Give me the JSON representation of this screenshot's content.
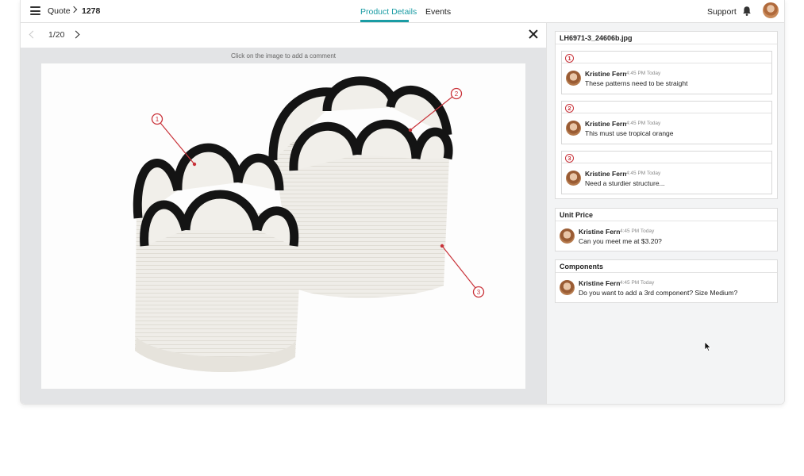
{
  "header": {
    "breadcrumb": [
      "Quote",
      "1278"
    ],
    "tabs": [
      {
        "label": "Product Details",
        "active": true
      },
      {
        "label": "Events",
        "active": false
      }
    ],
    "support_label": "Support",
    "accent_color": "#1a9ca4"
  },
  "viewer": {
    "page_counter": "1/20",
    "hint": "Click on the image to add a comment",
    "markers": [
      "1",
      "2",
      "3"
    ],
    "marker_color": "#c9333a"
  },
  "sidebar": {
    "file_name": "LH6971-3_24606b.jpg",
    "threads": [
      {
        "number": "1",
        "author": "Kristine Fern",
        "time": "4:45 PM Today",
        "text": "These patterns need to be straight"
      },
      {
        "number": "2",
        "author": "Kristine Fern",
        "time": "4:45 PM Today",
        "text": "This must use tropical orange"
      },
      {
        "number": "3",
        "author": "Kristine Fern",
        "time": "4:45 PM Today",
        "text": "Need a sturdier structure..."
      }
    ],
    "unit_price": {
      "title": "Unit Price",
      "author": "Kristine Fern",
      "time": "4:45 PM Today",
      "text": "Can you meet me at $3.20?"
    },
    "components": {
      "title": "Components",
      "author": "Kristine Fern",
      "time": "4:45 PM Today",
      "text": "Do you want to add a 3rd component? Size Medium?"
    }
  }
}
